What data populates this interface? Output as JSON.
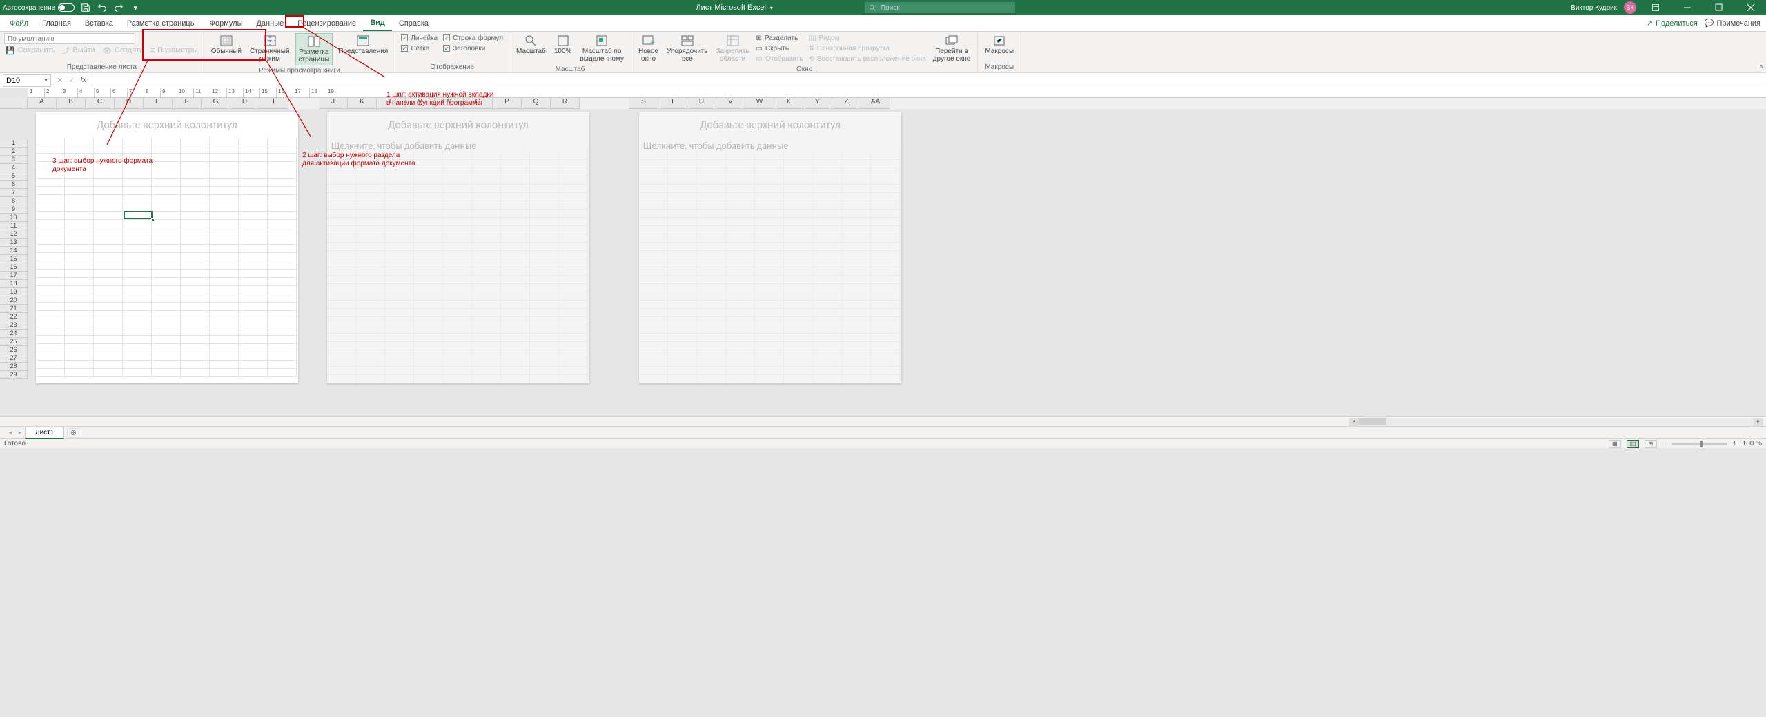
{
  "titlebar": {
    "autosave_label": "Автосохранение",
    "doc_title": "Лист Microsoft Excel",
    "search_placeholder": "Поиск",
    "user_name": "Виктор Кудрик",
    "user_initials": "ВК"
  },
  "tabs": {
    "items": [
      "Файл",
      "Главная",
      "Вставка",
      "Разметка страницы",
      "Формулы",
      "Данные",
      "Рецензирование",
      "Вид",
      "Справка"
    ],
    "active_index": 7,
    "share": "Поделиться",
    "comments": "Примечания"
  },
  "ribbon": {
    "group_view_sheet": {
      "label": "Представление листа",
      "default_text": "По умолчанию",
      "save": "Сохранить",
      "exit": "Выйти",
      "create": "Создать",
      "params": "Параметры"
    },
    "group_view_modes": {
      "label": "Режимы просмотра книги",
      "normal": "Обычный",
      "page_break": "Страничный\nрежим",
      "page_layout": "Разметка\nстраницы",
      "custom_views": "Представления"
    },
    "group_show": {
      "label": "Отображение",
      "ruler": "Линейка",
      "formula_bar": "Строка формул",
      "gridlines": "Сетка",
      "headings": "Заголовки"
    },
    "group_zoom": {
      "label": "Масштаб",
      "zoom": "Масштаб",
      "z100": "100%",
      "zoom_sel": "Масштаб по\nвыделенному"
    },
    "group_window": {
      "label": "Окно",
      "new_window": "Новое\nокно",
      "arrange_all": "Упорядочить\nвсе",
      "freeze": "Закрепить\nобласти",
      "split": "Разделить",
      "hide": "Скрыть",
      "unhide": "Отобразить",
      "side_by_side": "Рядом",
      "sync_scroll": "Синхронная прокрутка",
      "reset_pos": "Восстановить расположение окна",
      "switch": "Перейти в\nдругое окно"
    },
    "group_macros": {
      "label": "Макросы",
      "macros": "Макросы"
    }
  },
  "annotations": {
    "step1": "1 шаг: активация нужной вкладки\nв панели функций программы",
    "step2": "2 шаг: выбор нужного раздела\nдля активации формата документа",
    "step3": "3 шаг: выбор нужного формата\nдокумента"
  },
  "formula_bar": {
    "cell_ref": "D10"
  },
  "columns_p1": [
    "A",
    "B",
    "C",
    "D",
    "E",
    "F",
    "G",
    "H",
    "I"
  ],
  "columns_p2": [
    "J",
    "K",
    "L",
    "M",
    "N",
    "O",
    "P",
    "Q",
    "R"
  ],
  "columns_p3": [
    "S",
    "T",
    "U",
    "V",
    "W",
    "X",
    "Y",
    "Z",
    "AA"
  ],
  "rows": [
    "1",
    "2",
    "3",
    "4",
    "5",
    "6",
    "7",
    "8",
    "9",
    "10",
    "11",
    "12",
    "13",
    "14",
    "15",
    "16",
    "17",
    "18",
    "19",
    "20",
    "21",
    "22",
    "23",
    "24",
    "25",
    "26",
    "27",
    "28",
    "29"
  ],
  "ruler_ticks": [
    "1",
    "2",
    "3",
    "4",
    "5",
    "6",
    "7",
    "8",
    "9",
    "10",
    "11",
    "12",
    "13",
    "14",
    "15",
    "16",
    "17",
    "18",
    "19"
  ],
  "page": {
    "header_hint": "Добавьте верхний колонтитул",
    "add_data_hint": "Щелкните, чтобы добавить данные"
  },
  "sheet_tabs": {
    "sheet1": "Лист1"
  },
  "statusbar": {
    "ready": "Готово",
    "zoom": "100 %"
  },
  "colors": {
    "accent": "#217346",
    "anno": "#c00000"
  }
}
